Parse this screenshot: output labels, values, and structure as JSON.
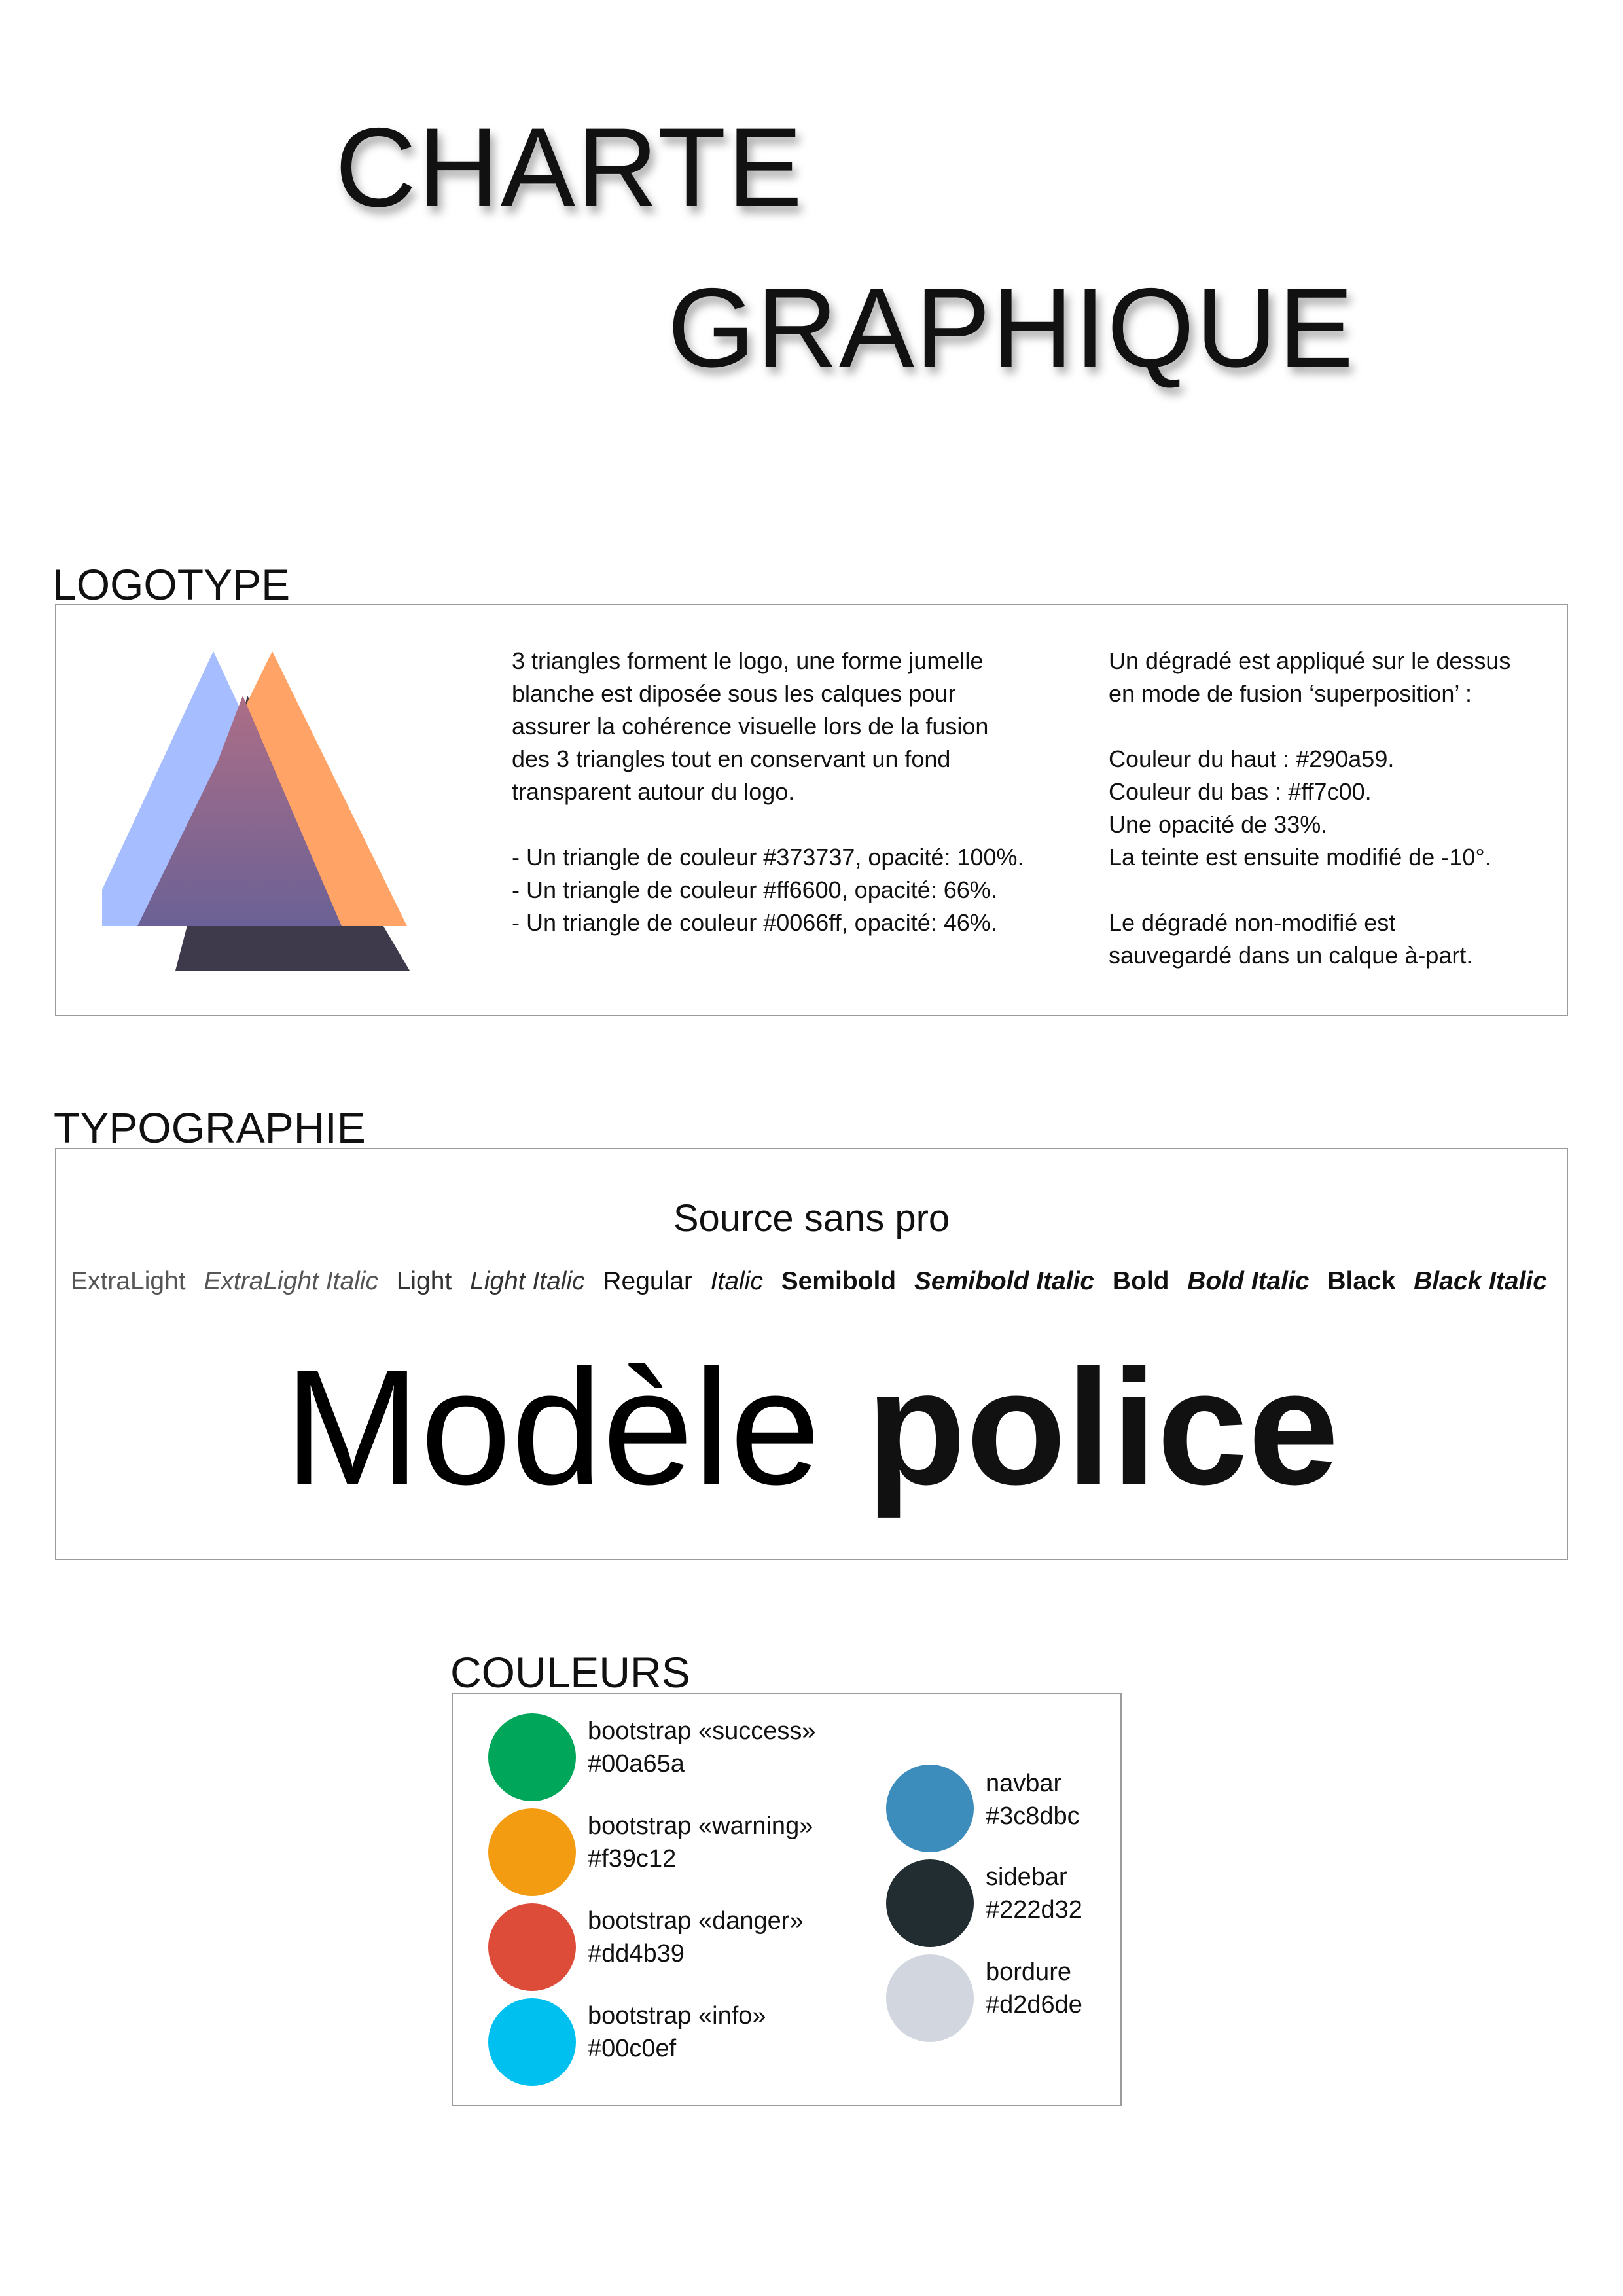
{
  "title": {
    "line1": "CHARTE",
    "line2": "GRAPHIQUE"
  },
  "logotype": {
    "label": "LOGOTYPE",
    "paragraph_left": [
      "3 triangles forment le logo, une forme jumelle",
      "blanche est diposée sous les calques pour",
      "assurer la cohérence visuelle lors de la fusion",
      "des 3 triangles tout en conservant un fond",
      "transparent autour du logo.",
      "",
      "- Un triangle de couleur #373737, opacité: 100%.",
      "- Un triangle de couleur #ff6600, opacité: 66%.",
      "- Un triangle de couleur #0066ff, opacité: 46%."
    ],
    "paragraph_right": [
      "Un dégradé est appliqué sur le dessus",
      "en mode de fusion ‘superposition’ :",
      "",
      "Couleur du haut : #290a59.",
      "Couleur du bas : #ff7c00.",
      "Une opacité de 33%.",
      "La teinte est ensuite modifié de -10°.",
      "",
      "Le dégradé non-modifié est",
      "sauvegardé dans un calque à-part."
    ],
    "colors": {
      "dark": "#373737",
      "orange": "#ff6600",
      "blue": "#0066ff",
      "grad_top": "#290a59",
      "grad_bottom": "#ff7c00"
    }
  },
  "typographie": {
    "label": "TYPOGRAPHIE",
    "font_name": "Source sans pro",
    "weights": [
      "ExtraLight",
      "ExtraLight Italic",
      "Light",
      "Light Italic",
      "Regular",
      "Italic",
      "Semibold",
      "Semibold Italic",
      "Bold",
      "Bold Italic",
      "Black",
      "Black Italic"
    ],
    "sample_thin": "Modèle",
    "sample_bold": "police"
  },
  "couleurs": {
    "label": "COULEURS",
    "left": [
      {
        "name": "bootstrap «success»",
        "hex": "#00a65a",
        "color": "#00a65a"
      },
      {
        "name": "bootstrap «warning»",
        "hex": "#f39c12",
        "color": "#f39c12"
      },
      {
        "name": "bootstrap «danger»",
        "hex": "#dd4b39",
        "color": "#dd4b39"
      },
      {
        "name": "bootstrap «info»",
        "hex": "#00c0ef",
        "color": "#00c0ef"
      }
    ],
    "right": [
      {
        "name": "navbar",
        "hex": "#3c8dbc",
        "color": "#3c8dbc"
      },
      {
        "name": "sidebar",
        "hex": "#222d32",
        "color": "#222d32"
      },
      {
        "name": "bordure",
        "hex": "#d2d6de",
        "color": "#d2d6de"
      }
    ]
  }
}
